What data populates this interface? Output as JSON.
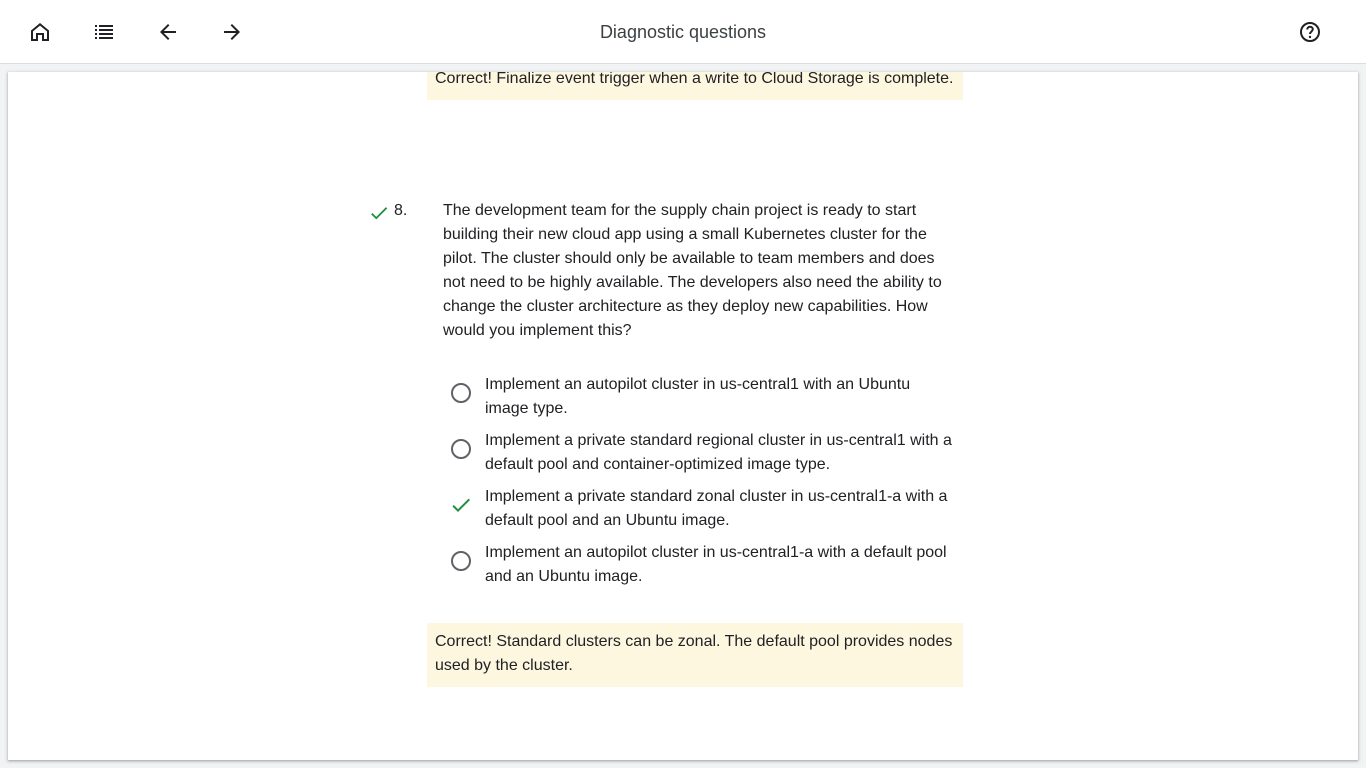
{
  "header": {
    "title": "Diagnostic questions",
    "icons": [
      "home-icon",
      "list-icon",
      "arrow-back-icon",
      "arrow-forward-icon",
      "help-icon"
    ]
  },
  "previous_feedback": {
    "text": "Correct! Finalize event trigger when a write to Cloud Storage is complete."
  },
  "question": {
    "number": "8.",
    "status": "correct",
    "text": "The development team for the supply chain project is ready to start building their new cloud app using a small Kubernetes cluster for the pilot. The cluster should only be available to team members and does not need to be highly available. The developers also need the ability to change the cluster architecture as they deploy new capabilities. How would you implement this?",
    "options": [
      {
        "label": "Implement an autopilot cluster in us-central1 with an Ubuntu image type.",
        "selected": false
      },
      {
        "label": "Implement a private standard regional cluster in us-central1 with a default pool and container-optimized image type.",
        "selected": false
      },
      {
        "label": "Implement a private standard zonal cluster in us-central1-a with a default pool and an Ubuntu image.",
        "selected": true
      },
      {
        "label": "Implement an autopilot cluster in us-central1-a with a default pool and an Ubuntu image.",
        "selected": false
      }
    ],
    "feedback": "Correct! Standard clusters can be zonal. The default pool provides nodes used by the cluster."
  },
  "colors": {
    "check_green": "#1e8e3e",
    "feedback_bg": "#fef7e0"
  }
}
